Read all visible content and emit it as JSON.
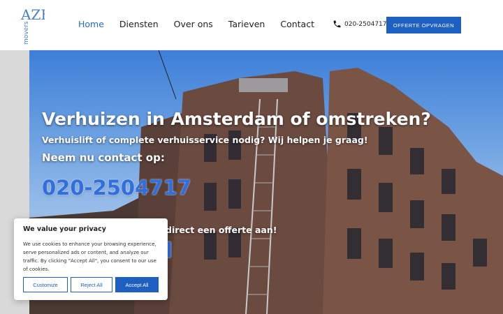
{
  "logo": {
    "letters": "AZF",
    "word": "movers"
  },
  "nav": {
    "items": [
      "Home",
      "Diensten",
      "Over ons",
      "Tarieven",
      "Contact"
    ],
    "active": "Home"
  },
  "header": {
    "phone": "020-2504717",
    "cta": "OFFERTE OPVRAGEN"
  },
  "hero": {
    "title": "Verhuizen in Amsterdam of omstreken?",
    "subtitle": "Verhuislift of complete verhuisservice nodig? Wij helpen je graag!",
    "contact_label": "Neem nu contact op:",
    "phone": "020-2504717",
    "offer_text": "direct een offerte aan!"
  },
  "cookie": {
    "title": "We value your privacy",
    "text": "We use cookies to enhance your browsing experience, serve personalized ads or content, and analyze our traffic. By clicking \"Accept All\", you consent to our use of cookies.",
    "customize": "Customize",
    "reject": "Reject All",
    "accept": "Accept All"
  },
  "colors": {
    "accent": "#1e5fc2",
    "nav_active": "#2a6bc4",
    "phone_blue": "#2f6fe0"
  }
}
